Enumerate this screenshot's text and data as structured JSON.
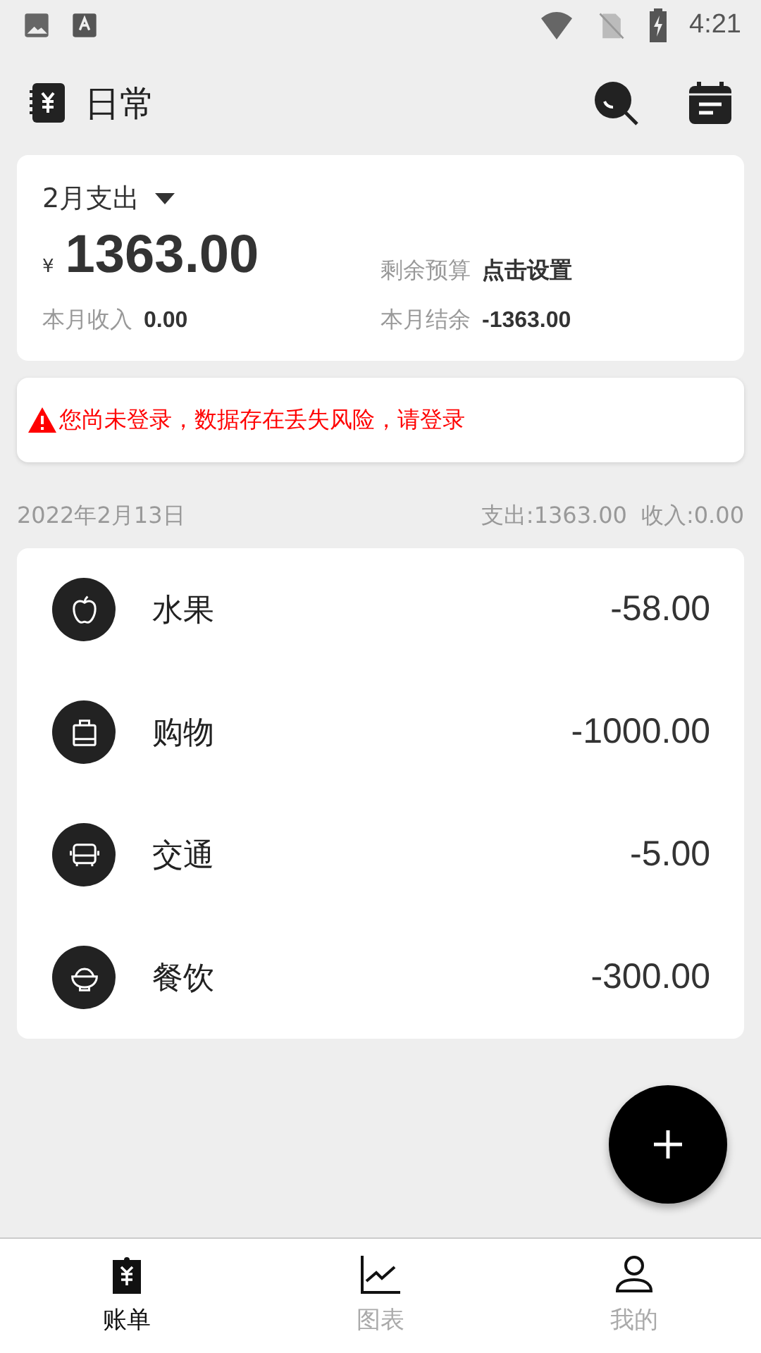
{
  "status_bar": {
    "time": "4:21"
  },
  "header": {
    "title": "日常"
  },
  "summary": {
    "month_label": "2月支出",
    "currency": "¥",
    "amount": "1363.00",
    "budget_label": "剩余预算",
    "budget_value": "点击设置",
    "income_label": "本月收入",
    "income_value": "0.00",
    "balance_label": "本月结余",
    "balance_value": "-1363.00"
  },
  "warning": {
    "text": "您尚未登录，数据存在丢失风险，请登录"
  },
  "day": {
    "date": "2022年2月13日",
    "expense": "支出:1363.00",
    "income": "收入:0.00"
  },
  "entries": [
    {
      "kind": "apple",
      "name": "水果",
      "amount": "-58.00"
    },
    {
      "kind": "bag",
      "name": "购物",
      "amount": "-1000.00"
    },
    {
      "kind": "bus",
      "name": "交通",
      "amount": "-5.00"
    },
    {
      "kind": "bowl",
      "name": "餐饮",
      "amount": "-300.00"
    }
  ],
  "tabs": [
    {
      "kind": "bill",
      "label": "账单",
      "selected": true
    },
    {
      "kind": "chart",
      "label": "图表",
      "selected": false
    },
    {
      "kind": "person",
      "label": "我的",
      "selected": false
    }
  ]
}
